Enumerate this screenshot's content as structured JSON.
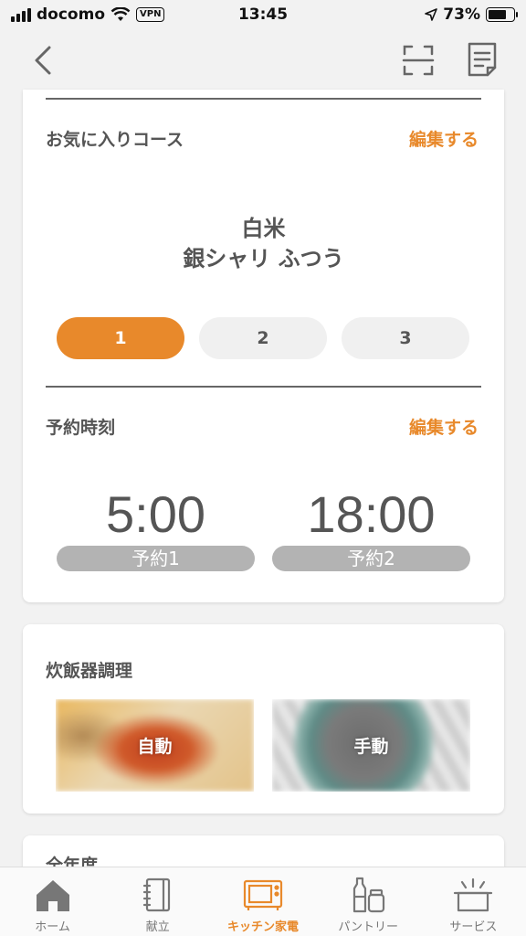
{
  "status_bar": {
    "carrier": "docomo",
    "vpn_label": "VPN",
    "time": "13:45",
    "battery_percent": "73%",
    "battery_level": 0.73
  },
  "nav": {
    "back_icon": "chevron-left-icon",
    "scan_icon": "scan-frame-icon",
    "note_icon": "note-icon"
  },
  "favorite_course": {
    "title": "お気に入りコース",
    "edit_label": "編集する",
    "course_line1": "白米",
    "course_line2": "銀シャリ ふつう",
    "slots": [
      "1",
      "2",
      "3"
    ],
    "active_slot": 0
  },
  "reservation": {
    "title": "予約時刻",
    "edit_label": "編集する",
    "items": [
      {
        "time": "5:00",
        "label": "予約1"
      },
      {
        "time": "18:00",
        "label": "予約2"
      }
    ]
  },
  "cooker": {
    "title": "炊飯器調理",
    "tiles": [
      {
        "label": "自動"
      },
      {
        "label": "手動"
      }
    ]
  },
  "partial_section": {
    "title": "全年度"
  },
  "tabs": [
    {
      "label": "ホーム",
      "icon": "home-icon"
    },
    {
      "label": "献立",
      "icon": "notebook-icon"
    },
    {
      "label": "キッチン家電",
      "icon": "microwave-icon"
    },
    {
      "label": "パントリー",
      "icon": "pantry-icon"
    },
    {
      "label": "サービス",
      "icon": "service-box-icon"
    }
  ],
  "active_tab": 2,
  "colors": {
    "accent": "#e8892b",
    "background": "#f2f2f2",
    "text": "#555555",
    "badge": "#b3b3b3"
  }
}
